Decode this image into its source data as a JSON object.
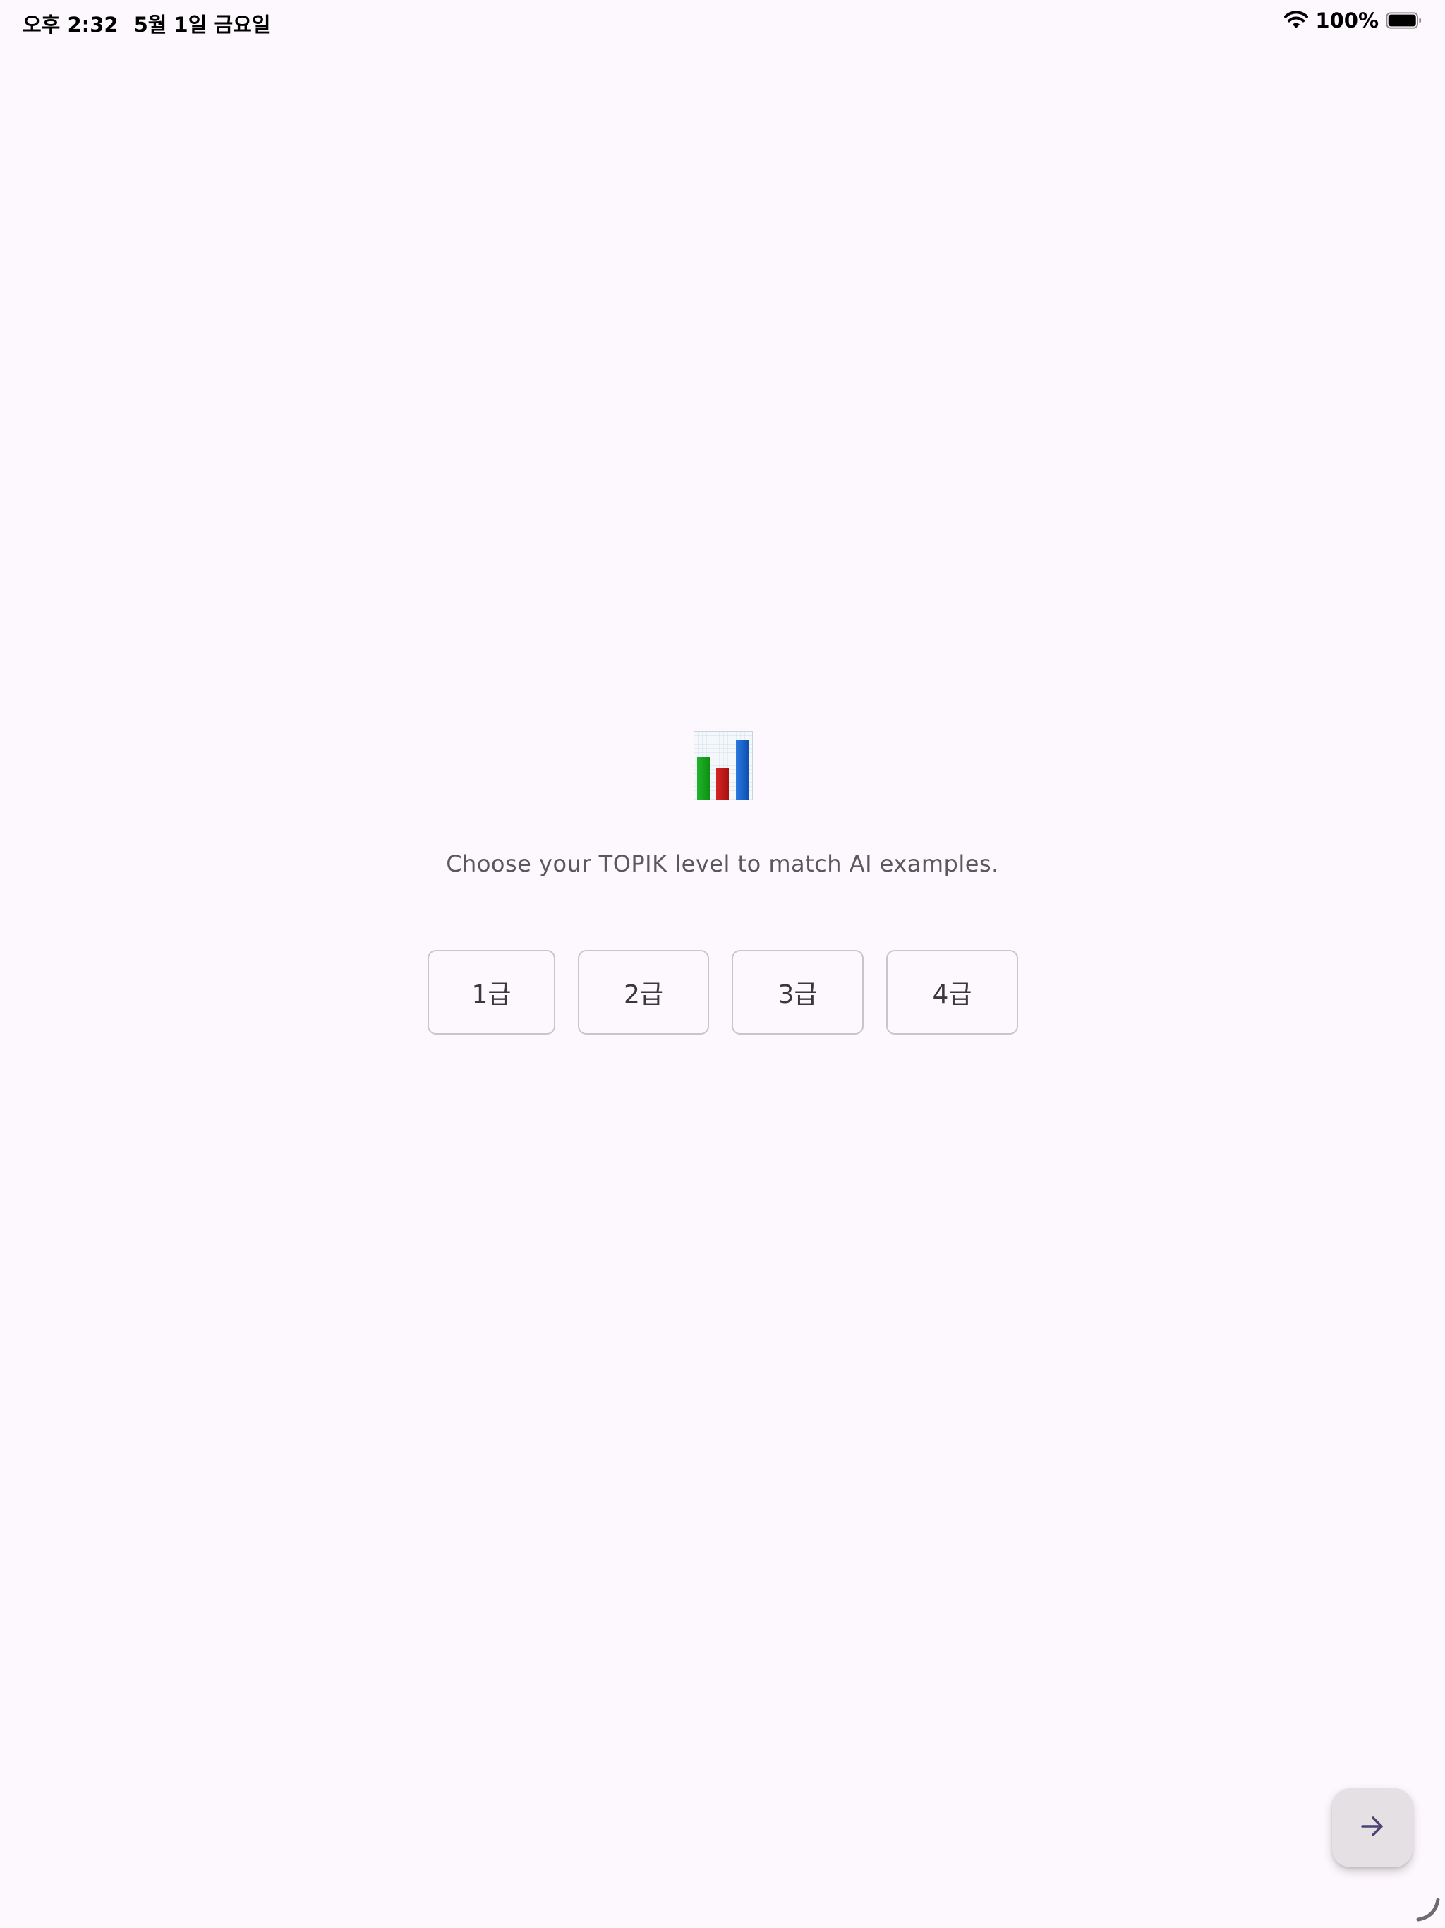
{
  "status_bar": {
    "time": "오후 2:32",
    "date": "5월 1일 금요일",
    "battery": "100%",
    "wifi_icon": "wifi-icon",
    "battery_icon": "battery-icon"
  },
  "main": {
    "icon": "bar-chart-icon",
    "subtitle": "Choose your TOPIK level to match AI examples.",
    "levels": [
      {
        "label": "1급"
      },
      {
        "label": "2급"
      },
      {
        "label": "3급"
      },
      {
        "label": "4급"
      }
    ]
  },
  "fab": {
    "icon": "arrow-right-icon",
    "background": "#e4e0e4",
    "icon_color": "#4a4474"
  },
  "colors": {
    "background": "#fdf8fd",
    "button_border": "#c9c5ca",
    "text_muted": "#5b575f"
  }
}
